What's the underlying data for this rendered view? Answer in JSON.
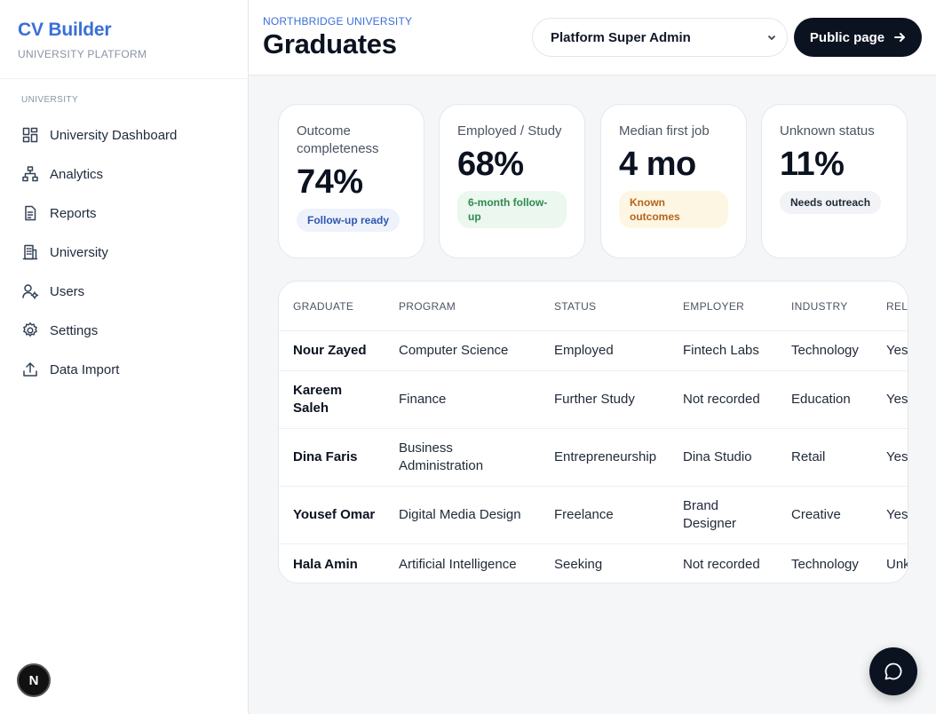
{
  "brand": {
    "title": "CV Builder",
    "subtitle": "UNIVERSITY PLATFORM"
  },
  "sidebar": {
    "section_label": "UNIVERSITY",
    "items": [
      {
        "label": "University Dashboard",
        "icon": "grid-icon"
      },
      {
        "label": "Analytics",
        "icon": "hierarchy-icon"
      },
      {
        "label": "Reports",
        "icon": "document-icon"
      },
      {
        "label": "University",
        "icon": "building-icon"
      },
      {
        "label": "Users",
        "icon": "user-gear-icon"
      },
      {
        "label": "Settings",
        "icon": "gear-icon"
      },
      {
        "label": "Data Import",
        "icon": "upload-icon"
      }
    ]
  },
  "avatar": {
    "initial": "N"
  },
  "header": {
    "org": "NORTHBRIDGE UNIVERSITY",
    "title": "Graduates",
    "role_select": "Platform Super Admin",
    "public_button": "Public page"
  },
  "cards": [
    {
      "label": "Outcome completeness",
      "value": "74%",
      "pill": "Follow-up ready"
    },
    {
      "label": "Employed / Study",
      "value": "68%",
      "pill": "6-month follow-up"
    },
    {
      "label": "Median first job",
      "value": "4 mo",
      "pill": "Known outcomes"
    },
    {
      "label": "Unknown status",
      "value": "11%",
      "pill": "Needs outreach"
    }
  ],
  "table": {
    "headers": [
      "GRADUATE",
      "PROGRAM",
      "STATUS",
      "EMPLOYER",
      "INDUSTRY",
      "REL"
    ],
    "rows": [
      [
        "Nour Zayed",
        "Computer Science",
        "Employed",
        "Fintech Labs",
        "Technology",
        "Yes"
      ],
      [
        "Kareem Saleh",
        "Finance",
        "Further Study",
        "Not recorded",
        "Education",
        "Yes"
      ],
      [
        "Dina Faris",
        "Business Administration",
        "Entrepreneurship",
        "Dina Studio",
        "Retail",
        "Yes"
      ],
      [
        "Yousef Omar",
        "Digital Media Design",
        "Freelance",
        "Brand Designer",
        "Creative",
        "Yes"
      ],
      [
        "Hala Amin",
        "Artificial Intelligence",
        "Seeking",
        "Not recorded",
        "Technology",
        "Unk"
      ]
    ]
  },
  "colors": {
    "accent": "#3a6fd8",
    "dark": "#0b1220",
    "background": "#f5f6f8"
  }
}
